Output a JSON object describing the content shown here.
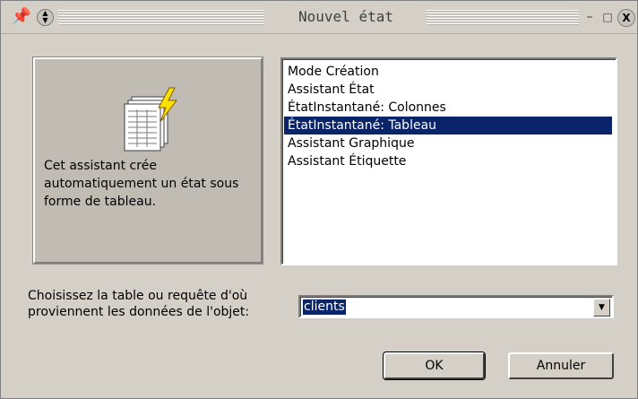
{
  "window": {
    "title": "Nouvel état",
    "icons": {
      "pin": "pin-icon",
      "scroll": "updown-icon",
      "minimize": "minimize-icon",
      "maximize": "maximize-icon",
      "close": "close-icon"
    }
  },
  "preview": {
    "icon": "report-wizard-icon",
    "description": "Cet assistant crée automatiquement un état sous forme de tableau."
  },
  "list": {
    "items": [
      "Mode Création",
      "Assistant État",
      "ÉtatInstantané:  Colonnes",
      "ÉtatInstantané:  Tableau",
      "Assistant Graphique",
      "Assistant Étiquette"
    ],
    "selected_index": 3
  },
  "source": {
    "prompt": "Choisissez la table ou requête d'où proviennent les données de l'objet:",
    "value": "clients"
  },
  "buttons": {
    "ok": "OK",
    "cancel": "Annuler"
  },
  "colors": {
    "selection": "#0a246a",
    "window_bg": "#d4d0c8"
  }
}
